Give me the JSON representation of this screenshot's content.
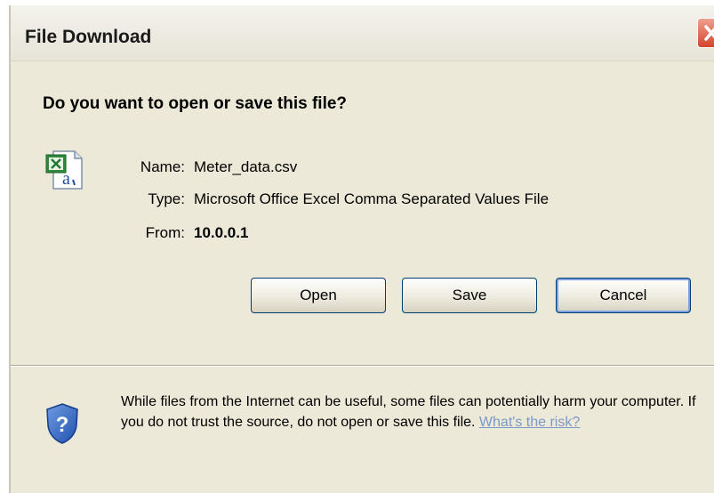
{
  "dialog": {
    "title": "File Download",
    "question": "Do you want to open or save this file?"
  },
  "file": {
    "icon": "excel-csv-file-icon",
    "name_label": "Name:",
    "name_value": "Meter_data.csv",
    "type_label": "Type:",
    "type_value": "Microsoft Office Excel Comma Separated Values File",
    "from_label": "From:",
    "from_value": "10.0.0.1"
  },
  "buttons": {
    "open": "Open",
    "save": "Save",
    "cancel": "Cancel"
  },
  "warning": {
    "text": "While files from the Internet can be useful, some files can potentially harm your computer. If you do not trust the source, do not open or save this file.",
    "link": "What's the risk?"
  },
  "colors": {
    "dialog_bg": "#ece9d8",
    "close_button": "#d4452c",
    "button_border": "#003c74",
    "link": "#7c98c8"
  }
}
